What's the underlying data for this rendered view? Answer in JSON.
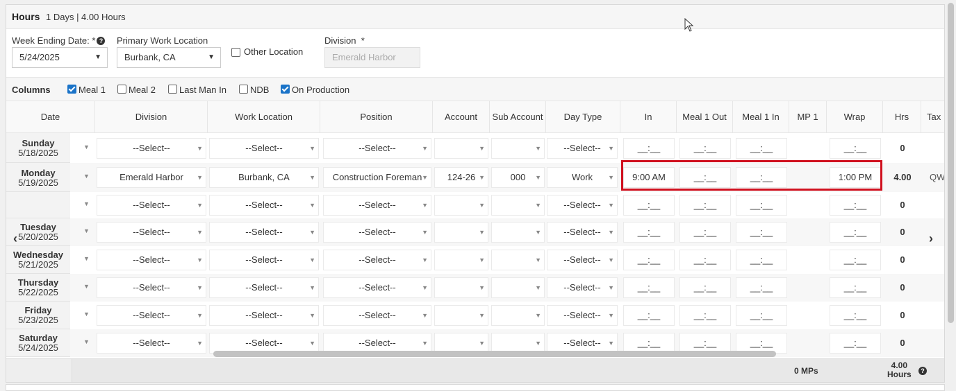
{
  "header": {
    "title": "Hours",
    "summary": "1 Days | 4.00 Hours"
  },
  "form": {
    "week_ending_label": "Week Ending Date: *",
    "week_ending_value": "5/24/2025",
    "primary_location_label": "Primary Work Location",
    "primary_location_value": "Burbank, CA",
    "other_location_label": "Other Location",
    "division_label": "Division  *",
    "division_value": "Emerald Harbor"
  },
  "columns_toggle": {
    "label": "Columns",
    "items": [
      {
        "label": "Meal 1",
        "checked": true
      },
      {
        "label": "Meal 2",
        "checked": false
      },
      {
        "label": "Last Man In",
        "checked": false
      },
      {
        "label": "NDB",
        "checked": false
      },
      {
        "label": "On Production",
        "checked": true
      }
    ]
  },
  "table": {
    "headers": [
      "Date",
      "Division",
      "Work Location",
      "Position",
      "Account",
      "Sub Account",
      "Day Type",
      "In",
      "Meal 1 Out",
      "Meal 1 In",
      "MP 1",
      "Wrap",
      "Hrs",
      "Tax"
    ],
    "select_placeholder": "--Select--",
    "time_placeholder": "__:__",
    "rows": [
      {
        "day": "Sunday",
        "date": "5/18/2025",
        "division": "--Select--",
        "location": "--Select--",
        "position": "--Select--",
        "account": "",
        "sub_account": "",
        "day_type": "--Select--",
        "in": "__:__",
        "meal_out": "__:__",
        "meal_in": "__:__",
        "wrap": "__:__",
        "hrs": "0",
        "tax": ""
      },
      {
        "day": "Monday",
        "date": "5/19/2025",
        "division": "Emerald Harbor",
        "location": "Burbank, CA",
        "position": "Construction Foreman",
        "account": "124-26",
        "sub_account": "000",
        "day_type": "Work",
        "in": "9:00 AM",
        "meal_out": "__:__",
        "meal_in": "__:__",
        "wrap": "1:00 PM",
        "hrs": "4.00",
        "tax": "QW"
      },
      {
        "day": "",
        "date": "",
        "division": "--Select--",
        "location": "--Select--",
        "position": "--Select--",
        "account": "",
        "sub_account": "",
        "day_type": "--Select--",
        "in": "__:__",
        "meal_out": "__:__",
        "meal_in": "__:__",
        "wrap": "__:__",
        "hrs": "0",
        "tax": ""
      },
      {
        "day": "Tuesday",
        "date": "5/20/2025",
        "division": "--Select--",
        "location": "--Select--",
        "position": "--Select--",
        "account": "",
        "sub_account": "",
        "day_type": "--Select--",
        "in": "__:__",
        "meal_out": "__:__",
        "meal_in": "__:__",
        "wrap": "__:__",
        "hrs": "0",
        "tax": ""
      },
      {
        "day": "Wednesday",
        "date": "5/21/2025",
        "division": "--Select--",
        "location": "--Select--",
        "position": "--Select--",
        "account": "",
        "sub_account": "",
        "day_type": "--Select--",
        "in": "__:__",
        "meal_out": "__:__",
        "meal_in": "__:__",
        "wrap": "__:__",
        "hrs": "0",
        "tax": ""
      },
      {
        "day": "Thursday",
        "date": "5/22/2025",
        "division": "--Select--",
        "location": "--Select--",
        "position": "--Select--",
        "account": "",
        "sub_account": "",
        "day_type": "--Select--",
        "in": "__:__",
        "meal_out": "__:__",
        "meal_in": "__:__",
        "wrap": "__:__",
        "hrs": "0",
        "tax": ""
      },
      {
        "day": "Friday",
        "date": "5/23/2025",
        "division": "--Select--",
        "location": "--Select--",
        "position": "--Select--",
        "account": "",
        "sub_account": "",
        "day_type": "--Select--",
        "in": "__:__",
        "meal_out": "__:__",
        "meal_in": "__:__",
        "wrap": "__:__",
        "hrs": "0",
        "tax": ""
      },
      {
        "day": "Saturday",
        "date": "5/24/2025",
        "division": "--Select--",
        "location": "--Select--",
        "position": "--Select--",
        "account": "",
        "sub_account": "",
        "day_type": "--Select--",
        "in": "__:__",
        "meal_out": "__:__",
        "meal_in": "__:__",
        "wrap": "__:__",
        "hrs": "0",
        "tax": ""
      }
    ]
  },
  "footer": {
    "mps": "0 MPs",
    "total_value": "4.00",
    "total_label": "Hours"
  },
  "icons": {
    "dropdown": "caret-down-icon",
    "help": "question-circle-icon",
    "scroll_left": "chevron-left-icon",
    "scroll_right": "chevron-right-icon",
    "cursor": "mouse-pointer-icon"
  },
  "colors": {
    "highlight": "#d0101e",
    "checkbox_on": "#1a73c8"
  }
}
